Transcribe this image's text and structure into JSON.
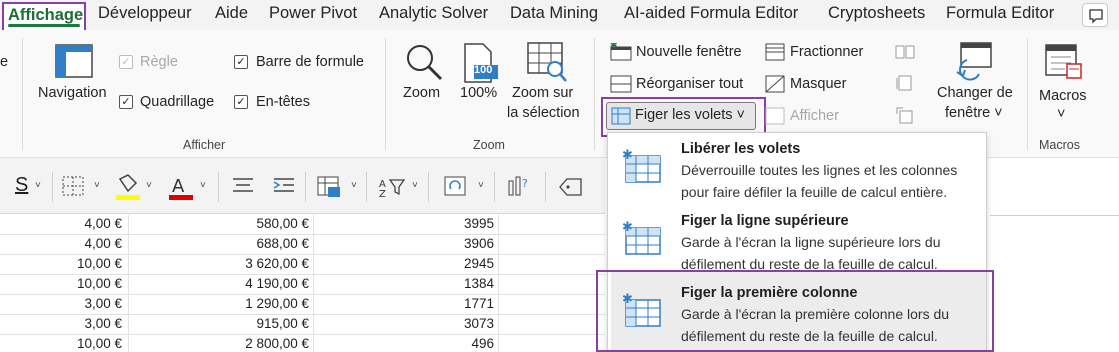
{
  "tabs": [
    {
      "label": "Affichage",
      "active": true
    },
    {
      "label": "Développeur"
    },
    {
      "label": "Aide"
    },
    {
      "label": "Power Pivot"
    },
    {
      "label": "Analytic Solver"
    },
    {
      "label": "Data Mining"
    },
    {
      "label": "AI-aided Formula Editor"
    },
    {
      "label": "Cryptosheets"
    },
    {
      "label": "Formula Editor"
    }
  ],
  "ribbon": {
    "cut_label": "e",
    "navigation": "Navigation",
    "regle": "Règle",
    "quadrillage": "Quadrillage",
    "barre_formule": "Barre de formule",
    "en_tetes": "En-têtes",
    "group_afficher": "Afficher",
    "zoom": "Zoom",
    "zoom100": "100%",
    "zoom100_icon": "100",
    "zoom_sel_1": "Zoom sur",
    "zoom_sel_2": "la sélection",
    "group_zoom": "Zoom",
    "nouvelle_fenetre": "Nouvelle fenêtre",
    "reorganiser": "Réorganiser tout",
    "figer": "Figer les volets ˅",
    "fractionner": "Fractionner",
    "masquer": "Masquer",
    "afficher": "Afficher",
    "changer_1": "Changer de",
    "changer_2": "fenêtre ˅",
    "macros": "Macros",
    "macros_arrow": "˅",
    "group_macros": "Macros"
  },
  "toolbar": {
    "underline_icon": "S"
  },
  "menu": {
    "items": [
      {
        "title": "Libérer les volets",
        "desc": "Déverrouille toutes les lignes et les colonnes pour faire défiler la feuille de calcul entière."
      },
      {
        "title": "Figer la ligne supérieure",
        "desc": "Garde à l'écran la ligne supérieure lors du défilement du reste de la feuille de calcul."
      },
      {
        "title": "Figer la première colonne",
        "desc": "Garde à l'écran la première colonne lors du défilement du reste de la feuille de calcul."
      }
    ]
  },
  "rows": [
    {
      "a": "4,00 €",
      "b": "580,00 €",
      "c": "3995"
    },
    {
      "a": "4,00 €",
      "b": "688,00 €",
      "c": "3906"
    },
    {
      "a": "10,00 €",
      "b": "3 620,00 €",
      "c": "2945"
    },
    {
      "a": "10,00 €",
      "b": "4 190,00 €",
      "c": "1384"
    },
    {
      "a": "3,00 €",
      "b": "1 290,00 €",
      "c": "1771"
    },
    {
      "a": "3,00 €",
      "b": "915,00 €",
      "c": "3073"
    },
    {
      "a": "10,00 €",
      "b": "2 800,00 €",
      "c": "496"
    }
  ],
  "colors": {
    "accent_purple": "#8b3fa0",
    "excel_green": "#1b7a3e"
  }
}
